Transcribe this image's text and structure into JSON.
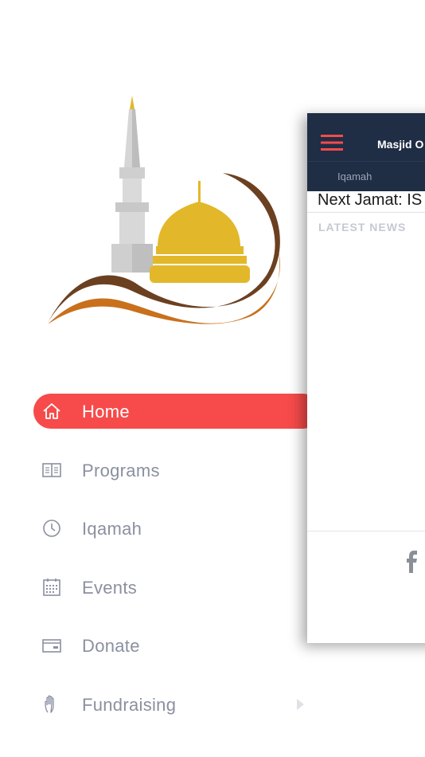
{
  "logo": {
    "icon": "mosque-logo",
    "colors": {
      "minaret": "#d0d0d0",
      "dome": "#e2b82a",
      "brown": "#6b4020",
      "orange": "#c9701c"
    }
  },
  "menu": {
    "accent": "#f64b4a",
    "items": [
      {
        "label": "Home",
        "icon": "home-icon",
        "active": true
      },
      {
        "label": "Programs",
        "icon": "book-icon"
      },
      {
        "label": "Iqamah",
        "icon": "clock-icon"
      },
      {
        "label": "Events",
        "icon": "calendar-icon"
      },
      {
        "label": "Donate",
        "icon": "card-icon"
      },
      {
        "label": "Fundraising",
        "icon": "hand-icon",
        "has_submenu": true
      }
    ]
  },
  "card": {
    "title": "Masjid O",
    "tab": "Iqamah",
    "next_jamat": "Next Jamat: IS",
    "section_title": "LATEST NEWS",
    "footer_icon": "facebook-icon"
  }
}
